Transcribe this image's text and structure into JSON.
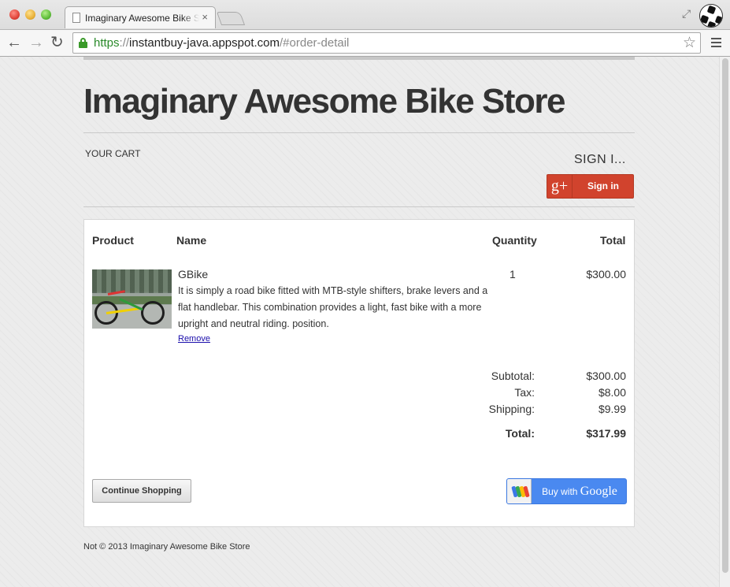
{
  "browser": {
    "tab_title": "Imaginary Awesome Bike Store",
    "tab_close": "×",
    "url_scheme": "https",
    "url_sep": "://",
    "url_host": "instantbuy-java.appspot.com",
    "url_path": "/#order-detail",
    "back_glyph": "←",
    "forward_glyph": "→",
    "reload_glyph": "↻",
    "star_glyph": "☆",
    "resize_glyph": "⤢"
  },
  "header": {
    "store_title": "Imaginary Awesome Bike Store",
    "your_cart": "YOUR CART",
    "sign_in_label": "SIGN I...",
    "gplus_icon_text": "g+",
    "gplus_button_label": "Sign in"
  },
  "cart": {
    "columns": {
      "product": "Product",
      "name": "Name",
      "quantity": "Quantity",
      "total": "Total"
    },
    "item": {
      "name": "GBike",
      "description": "It is simply a road bike fitted with MTB-style shifters, brake levers and a flat handlebar. This combination provides a light, fast bike with a more upright and neutral riding. position.",
      "remove_label": "Remove",
      "quantity": "1",
      "total": "$300.00"
    },
    "summary": {
      "subtotal_label": "Subtotal:",
      "subtotal": "$300.00",
      "tax_label": "Tax:",
      "tax": "$8.00",
      "shipping_label": "Shipping:",
      "shipping": "$9.99",
      "total_label": "Total:",
      "total": "$317.99"
    },
    "continue_label": "Continue Shopping",
    "buy_prefix": "Buy with",
    "buy_brand": "Google"
  },
  "footer": {
    "text": "Not © 2013 Imaginary Awesome Bike Store"
  },
  "colors": {
    "gplus": "#d1432d",
    "wallet_button": "#4a89f0",
    "link": "#1a0dab",
    "secure_green": "#2a8a2a"
  }
}
